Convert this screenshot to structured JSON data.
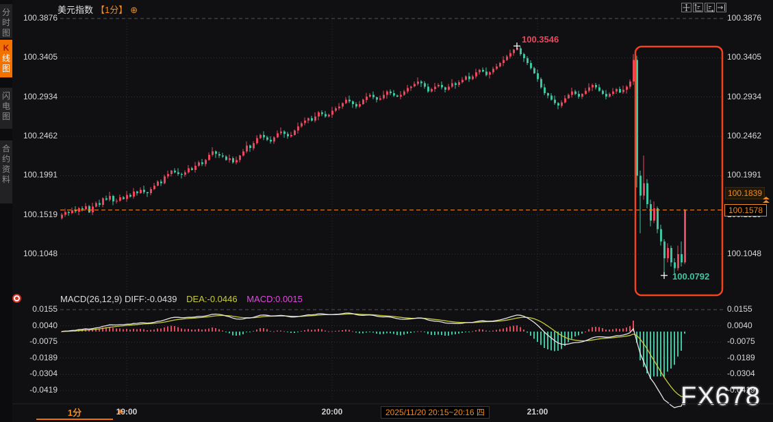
{
  "sidebar": {
    "tabs": [
      {
        "label": "分时图",
        "active": false
      },
      {
        "label": "K线图",
        "k": "K",
        "rest": "线图",
        "active": true
      },
      {
        "label": "闪电图",
        "active": false
      },
      {
        "label": "合约资料",
        "active": false
      }
    ]
  },
  "header": {
    "title": "美元指数",
    "interval": "【1分】",
    "settings_icon": "⊕"
  },
  "toolbar": {
    "buttons": [
      {
        "name": "pan"
      },
      {
        "name": "zoom-y-axis"
      },
      {
        "name": "zoom-x-axis"
      },
      {
        "name": "jump-to-latest"
      }
    ]
  },
  "macd_header": {
    "params": "MACD(26,12,9)",
    "diff": "DIFF:-0.0439",
    "dea": "DEA:-0.0446",
    "macd": "MACD:0.0015"
  },
  "footer": {
    "interval": "1分",
    "arrow": "▲",
    "range_label": "2025/11/20 20:15~20:16 四"
  },
  "watermark": "FX678",
  "colors": {
    "up": "#e8485e",
    "down": "#3ec6a2",
    "accent_orange": "#f08c21",
    "diff_line": "#e6e6e6",
    "dea_line": "#c9cd3a",
    "hist_up": "#e8485e",
    "hist_down": "#3ec6a2",
    "box": "#f5421e",
    "grid": "#35353a",
    "grid_top": "#55555a"
  },
  "chart_data": {
    "type": "candlestick",
    "title": "美元指数 1分",
    "price_axis_ticks": [
      100.3876,
      100.3405,
      100.2934,
      100.2462,
      100.1991,
      100.1519,
      100.1048
    ],
    "macd_axis_ticks": [
      0.0155,
      0.004,
      -0.0075,
      -0.0189,
      -0.0304,
      -0.0419
    ],
    "x_ticks": [
      "19:00",
      "20:00",
      "21:00"
    ],
    "high": 100.3546,
    "low": 100.0792,
    "last": 100.1578,
    "ref": 100.1839,
    "macd": {
      "fast": 12,
      "slow": 26,
      "signal": 9,
      "diff": -0.0439,
      "dea": -0.0446,
      "hist": 0.0015
    },
    "candles": [
      [
        100.148,
        100.154,
        100.1465,
        100.152
      ],
      [
        100.152,
        100.1595,
        100.1495,
        100.1555
      ],
      [
        100.1555,
        100.1565,
        100.151,
        100.154
      ],
      [
        100.154,
        100.1605,
        100.153,
        100.1575
      ],
      [
        100.1575,
        100.1625,
        100.154,
        100.156
      ],
      [
        100.156,
        100.1615,
        100.1515,
        100.16
      ],
      [
        100.16,
        100.1625,
        100.156,
        100.1585
      ],
      [
        100.1585,
        100.166,
        100.157,
        100.1625
      ],
      [
        100.1625,
        100.164,
        100.154,
        100.155
      ],
      [
        100.155,
        100.1665,
        100.1515,
        100.162
      ],
      [
        100.162,
        100.168,
        100.1605,
        100.166
      ],
      [
        100.166,
        100.17,
        100.1615,
        100.164
      ],
      [
        100.164,
        100.173,
        100.161,
        100.172
      ],
      [
        100.172,
        100.175,
        100.169,
        100.17
      ],
      [
        100.17,
        100.1795,
        100.168,
        100.1745
      ],
      [
        100.1745,
        100.176,
        100.1635,
        100.168
      ],
      [
        100.168,
        100.1715,
        100.1655,
        100.169
      ],
      [
        100.169,
        100.1765,
        100.1675,
        100.173
      ],
      [
        100.173,
        100.1745,
        100.17,
        100.171
      ],
      [
        100.171,
        100.1805,
        100.1675,
        100.176
      ],
      [
        100.176,
        100.178,
        100.1725,
        100.174
      ],
      [
        100.174,
        100.184,
        100.1715,
        100.18
      ],
      [
        100.18,
        100.181,
        100.175,
        100.178
      ],
      [
        100.178,
        100.185,
        100.177,
        100.182
      ],
      [
        100.182,
        100.187,
        100.177,
        100.179
      ],
      [
        100.179,
        100.1795,
        100.1735,
        100.178
      ],
      [
        100.178,
        100.1855,
        100.1755,
        100.183
      ],
      [
        100.183,
        100.1905,
        100.1815,
        100.187
      ],
      [
        100.187,
        100.1935,
        100.186,
        100.192
      ],
      [
        100.192,
        100.1945,
        100.1865,
        100.19
      ],
      [
        100.19,
        100.2,
        100.1885,
        100.198
      ],
      [
        100.198,
        100.205,
        100.1955,
        100.201
      ],
      [
        100.201,
        100.206,
        100.198,
        100.205
      ],
      [
        100.205,
        100.208,
        100.202,
        100.203
      ],
      [
        100.203,
        100.208,
        100.199,
        100.201
      ],
      [
        100.201,
        100.2025,
        100.1955,
        100.2
      ],
      [
        100.2,
        100.2055,
        100.1975,
        100.203
      ],
      [
        100.203,
        100.2115,
        100.2015,
        100.208
      ],
      [
        100.208,
        100.2095,
        100.205,
        100.206
      ],
      [
        100.206,
        100.2155,
        100.2025,
        100.211
      ],
      [
        100.211,
        100.217,
        100.2095,
        100.215
      ],
      [
        100.215,
        100.219,
        100.2105,
        100.213
      ],
      [
        100.213,
        100.219,
        100.21,
        100.218
      ],
      [
        100.218,
        100.227,
        100.217,
        100.224
      ],
      [
        100.224,
        100.233,
        100.222,
        100.228
      ],
      [
        100.228,
        100.2295,
        100.2205,
        100.225
      ],
      [
        100.225,
        100.2275,
        100.2205,
        100.223
      ],
      [
        100.223,
        100.2265,
        100.2205,
        100.222
      ],
      [
        100.222,
        100.2235,
        100.217,
        100.218
      ],
      [
        100.218,
        100.2245,
        100.2145,
        100.22
      ],
      [
        100.22,
        100.222,
        100.2135,
        100.215
      ],
      [
        100.215,
        100.222,
        100.2125,
        100.218
      ],
      [
        100.218,
        100.224,
        100.215,
        100.223
      ],
      [
        100.223,
        100.231,
        100.222,
        100.228
      ],
      [
        100.228,
        100.24,
        100.226,
        100.235
      ],
      [
        100.235,
        100.2365,
        100.2275,
        100.232
      ],
      [
        100.232,
        100.2405,
        100.2295,
        100.238
      ],
      [
        100.238,
        100.2475,
        100.2365,
        100.244
      ],
      [
        100.244,
        100.2495,
        100.243,
        100.248
      ],
      [
        100.248,
        100.2525,
        100.2415,
        100.245
      ],
      [
        100.245,
        100.247,
        100.2405,
        100.242
      ],
      [
        100.242,
        100.246,
        100.2375,
        100.24
      ],
      [
        100.24,
        100.246,
        100.237,
        100.245
      ],
      [
        100.245,
        100.253,
        100.244,
        100.25
      ],
      [
        100.25,
        100.257,
        100.248,
        100.252
      ],
      [
        100.252,
        100.2535,
        100.2445,
        100.249
      ],
      [
        100.249,
        100.2515,
        100.2435,
        100.246
      ],
      [
        100.246,
        100.2515,
        100.2445,
        100.248
      ],
      [
        100.248,
        100.2545,
        100.247,
        100.253
      ],
      [
        100.253,
        100.2625,
        100.2495,
        100.258
      ],
      [
        100.258,
        100.264,
        100.2565,
        100.262
      ],
      [
        100.262,
        100.269,
        100.2595,
        100.265
      ],
      [
        100.265,
        100.269,
        100.262,
        100.268
      ],
      [
        100.268,
        100.271,
        100.264,
        100.265
      ],
      [
        100.265,
        100.275,
        100.263,
        100.27
      ],
      [
        100.27,
        100.2765,
        100.2655,
        100.275
      ],
      [
        100.275,
        100.2775,
        100.2705,
        100.273
      ],
      [
        100.273,
        100.2765,
        100.2685,
        100.27
      ],
      [
        100.27,
        100.2735,
        100.269,
        100.272
      ],
      [
        100.272,
        100.2815,
        100.2685,
        100.277
      ],
      [
        100.277,
        100.282,
        100.2755,
        100.28
      ],
      [
        100.28,
        100.286,
        100.2775,
        100.282
      ],
      [
        100.282,
        100.287,
        100.279,
        100.286
      ],
      [
        100.286,
        100.293,
        100.285,
        100.29
      ],
      [
        100.29,
        100.295,
        100.286,
        100.288
      ],
      [
        100.288,
        100.2895,
        100.2805,
        100.285
      ],
      [
        100.285,
        100.2875,
        100.2795,
        100.282
      ],
      [
        100.282,
        100.2885,
        100.2805,
        100.285
      ],
      [
        100.285,
        100.2915,
        100.284,
        100.29
      ],
      [
        100.29,
        100.2985,
        100.2865,
        100.294
      ],
      [
        100.294,
        100.298,
        100.2925,
        100.296
      ],
      [
        100.296,
        100.3,
        100.2905,
        100.293
      ],
      [
        100.293,
        100.294,
        100.287,
        100.29
      ],
      [
        100.29,
        100.295,
        100.289,
        100.292
      ],
      [
        100.292,
        100.301,
        100.29,
        100.296
      ],
      [
        100.296,
        100.3015,
        100.2915,
        100.3
      ],
      [
        100.3,
        100.3025,
        100.2955,
        100.298
      ],
      [
        100.298,
        100.3015,
        100.2935,
        100.295
      ],
      [
        100.295,
        100.2965,
        100.293,
        100.294
      ],
      [
        100.294,
        100.3005,
        100.2905,
        100.296
      ],
      [
        100.296,
        100.302,
        100.2945,
        100.3
      ],
      [
        100.3,
        100.308,
        100.2975,
        100.304
      ],
      [
        100.304,
        100.307,
        100.301,
        100.306
      ],
      [
        100.306,
        100.312,
        100.305,
        100.309
      ],
      [
        100.309,
        100.317,
        100.307,
        100.312
      ],
      [
        100.312,
        100.3135,
        100.3055,
        100.31
      ],
      [
        100.31,
        100.3125,
        100.3035,
        100.306
      ],
      [
        100.306,
        100.3095,
        100.2985,
        100.3
      ],
      [
        100.3,
        100.3045,
        100.299,
        100.303
      ],
      [
        100.303,
        100.3105,
        100.2995,
        100.306
      ],
      [
        100.306,
        100.31,
        100.3045,
        100.308
      ],
      [
        100.308,
        100.312,
        100.3025,
        100.305
      ],
      [
        100.305,
        100.306,
        100.299,
        100.302
      ],
      [
        100.302,
        100.309,
        100.301,
        100.306
      ],
      [
        100.306,
        100.315,
        100.304,
        100.31
      ],
      [
        100.31,
        100.3115,
        100.3035,
        100.308
      ],
      [
        100.308,
        100.3135,
        100.3055,
        100.311
      ],
      [
        100.311,
        100.3175,
        100.3095,
        100.314
      ],
      [
        100.314,
        100.3195,
        100.313,
        100.318
      ],
      [
        100.318,
        100.3225,
        100.3115,
        100.315
      ],
      [
        100.315,
        100.32,
        100.3135,
        100.318
      ],
      [
        100.318,
        100.327,
        100.3155,
        100.323
      ],
      [
        100.323,
        100.327,
        100.32,
        100.326
      ],
      [
        100.326,
        100.329,
        100.323,
        100.324
      ],
      [
        100.324,
        100.329,
        100.318,
        100.32
      ],
      [
        100.32,
        100.3245,
        100.3155,
        100.323
      ],
      [
        100.323,
        100.3295,
        100.3205,
        100.327
      ],
      [
        100.327,
        100.3335,
        100.3255,
        100.33
      ],
      [
        100.33,
        100.3355,
        100.329,
        100.334
      ],
      [
        100.334,
        100.3425,
        100.3305,
        100.338
      ],
      [
        100.338,
        100.344,
        100.3365,
        100.342
      ],
      [
        100.342,
        100.35,
        100.3395,
        100.346
      ],
      [
        100.346,
        100.351,
        100.343,
        100.35
      ],
      [
        100.35,
        100.3546,
        100.349,
        100.352
      ],
      [
        100.352,
        100.354,
        100.343,
        100.345
      ],
      [
        100.345,
        100.3465,
        100.3355,
        100.34
      ],
      [
        100.34,
        100.3425,
        100.3315,
        100.334
      ],
      [
        100.334,
        100.3375,
        100.3265,
        100.328
      ],
      [
        100.328,
        100.3295,
        100.321,
        100.322
      ],
      [
        100.322,
        100.3265,
        100.3115,
        100.315
      ],
      [
        100.315,
        100.317,
        100.3035,
        100.305
      ],
      [
        100.305,
        100.309,
        100.2955,
        100.298
      ],
      [
        100.298,
        100.299,
        100.292,
        100.295
      ],
      [
        100.295,
        100.298,
        100.289,
        100.29
      ],
      [
        100.29,
        100.295,
        100.284,
        100.286
      ],
      [
        100.286,
        100.2875,
        100.2785,
        100.283
      ],
      [
        100.283,
        100.2895,
        100.2805,
        100.287
      ],
      [
        100.287,
        100.2955,
        100.2855,
        100.292
      ],
      [
        100.292,
        100.2975,
        100.291,
        100.296
      ],
      [
        100.296,
        100.3045,
        100.2925,
        100.3
      ],
      [
        100.3,
        100.302,
        100.2955,
        100.297
      ],
      [
        100.297,
        100.301,
        100.2915,
        100.294
      ],
      [
        100.294,
        100.298,
        100.291,
        100.297
      ],
      [
        100.297,
        100.304,
        100.296,
        100.301
      ],
      [
        100.301,
        100.31,
        100.299,
        100.305
      ],
      [
        100.305,
        100.3095,
        100.3005,
        100.308
      ],
      [
        100.308,
        100.3105,
        100.3025,
        100.305
      ],
      [
        100.305,
        100.3085,
        100.2995,
        100.301
      ],
      [
        100.301,
        100.3025,
        100.296,
        100.297
      ],
      [
        100.297,
        100.3015,
        100.2905,
        100.294
      ],
      [
        100.294,
        100.299,
        100.2925,
        100.297
      ],
      [
        100.297,
        100.304,
        100.2945,
        100.3
      ],
      [
        100.3,
        100.304,
        100.297,
        100.303
      ],
      [
        100.303,
        100.306,
        100.298,
        100.299
      ],
      [
        100.299,
        100.307,
        100.297,
        100.302
      ],
      [
        100.302,
        100.3075,
        100.2975,
        100.306
      ],
      [
        100.306,
        100.3145,
        100.3035,
        100.312
      ],
      [
        100.312,
        100.345,
        100.308,
        100.338
      ],
      [
        100.338,
        100.343,
        100.185,
        100.199
      ],
      [
        100.199,
        100.205,
        100.13,
        100.175
      ],
      [
        100.175,
        100.223,
        100.17,
        100.19
      ],
      [
        100.19,
        100.195,
        100.16,
        100.165
      ],
      [
        100.165,
        100.17,
        100.138,
        100.145
      ],
      [
        100.145,
        100.168,
        100.142,
        100.16
      ],
      [
        100.16,
        100.162,
        100.13,
        100.135
      ],
      [
        100.135,
        100.14,
        100.115,
        100.12
      ],
      [
        100.12,
        100.123,
        100.0792,
        100.1
      ],
      [
        100.1,
        100.118,
        100.095,
        100.112
      ],
      [
        100.112,
        100.115,
        100.09,
        100.095
      ],
      [
        100.095,
        100.1,
        100.08,
        100.088
      ],
      [
        100.088,
        100.115,
        100.085,
        100.105
      ],
      [
        100.105,
        100.12,
        100.09,
        100.095
      ],
      [
        100.095,
        100.159,
        100.093,
        100.1578
      ]
    ]
  }
}
